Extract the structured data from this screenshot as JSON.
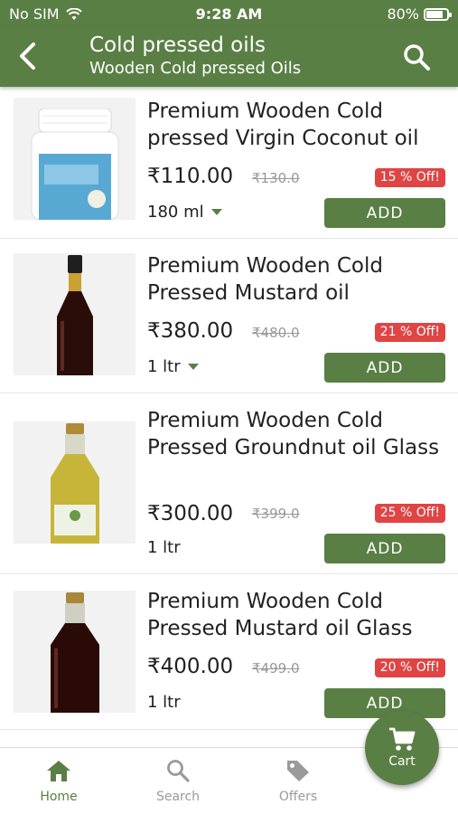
{
  "status_bar": {
    "carrier": "No SIM",
    "time": "9:28 AM",
    "battery": "80%",
    "battery_level": 0.8
  },
  "header": {
    "title": "Cold pressed oils",
    "subtitle": "Wooden Cold pressed Oils",
    "back_icon": "chevron-left-icon",
    "search_icon": "search-icon"
  },
  "products": [
    {
      "name": "Premium Wooden Cold pressed Virgin Coconut oil",
      "price": "₹110.00",
      "mrp": "₹130.0",
      "discount": "15 % Off!",
      "quantity": "180 ml",
      "has_dropdown": true,
      "add_label": "ADD"
    },
    {
      "name": "Premium Wooden Cold Pressed Mustard oil",
      "price": "₹380.00",
      "mrp": "₹480.0",
      "discount": "21 % Off!",
      "quantity": "1 ltr",
      "has_dropdown": true,
      "add_label": "ADD"
    },
    {
      "name": "Premium Wooden Cold Pressed Groundnut oil Glass",
      "price": "₹300.00",
      "mrp": "₹399.0",
      "discount": "25 % Off!",
      "quantity": "1 ltr",
      "has_dropdown": false,
      "add_label": "ADD"
    },
    {
      "name": "Premium Wooden Cold Pressed Mustard oil Glass",
      "price": "₹400.00",
      "mrp": "₹499.0",
      "discount": "20 % Off!",
      "quantity": "1 ltr",
      "has_dropdown": false,
      "add_label": "ADD"
    }
  ],
  "bottom_nav": [
    {
      "label": "Home",
      "icon": "home-icon",
      "active": true
    },
    {
      "label": "Search",
      "icon": "search-icon",
      "active": false
    },
    {
      "label": "Offers",
      "icon": "tag-icon",
      "active": false
    }
  ],
  "cart": {
    "label": "Cart",
    "icon": "cart-icon"
  },
  "colors": {
    "primary": "#5a7f45",
    "discount": "#e04444"
  }
}
